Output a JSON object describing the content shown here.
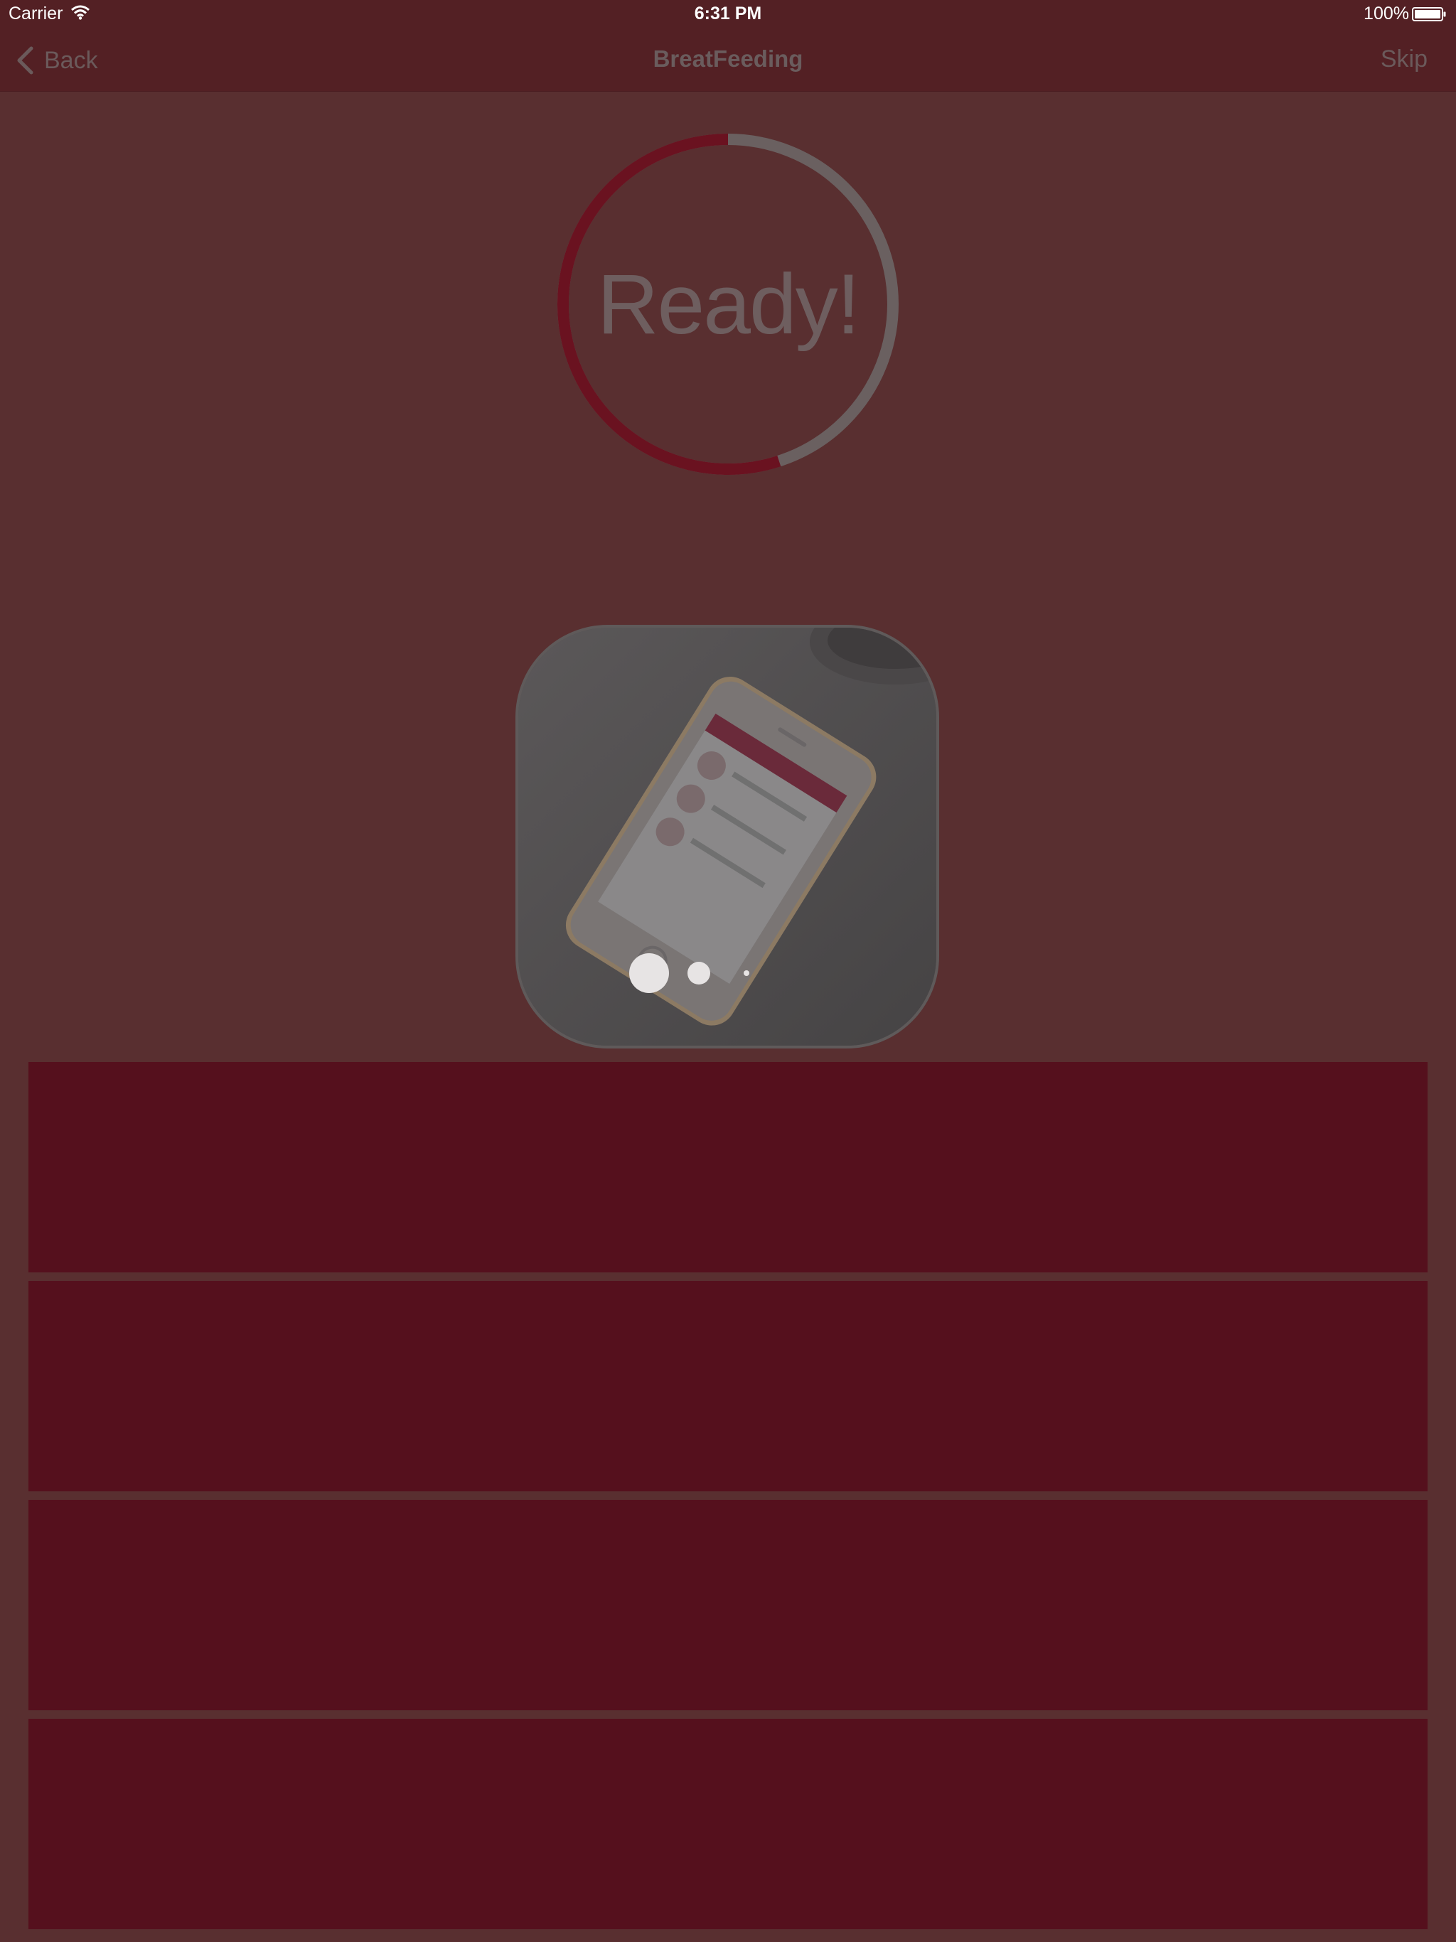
{
  "status_bar": {
    "carrier": "Carrier",
    "time": "6:31 PM",
    "battery": "100%"
  },
  "nav": {
    "back_label": "Back",
    "title": "BreatFeeding",
    "skip_label": "Skip"
  },
  "progress": {
    "label": "Ready!",
    "fraction": 0.55,
    "accent_color": "#6a1220",
    "track_color": "#6d6869"
  },
  "slideshow": {
    "page_count": 3,
    "current_page": 1
  },
  "options": [
    {
      "label": ""
    },
    {
      "label": ""
    },
    {
      "label": ""
    },
    {
      "label": ""
    }
  ],
  "colors": {
    "background": "#592f30",
    "bar": "#532024",
    "option": "#55101d"
  },
  "icons": [
    "wifi-icon",
    "battery-icon",
    "back-chevron-icon"
  ]
}
